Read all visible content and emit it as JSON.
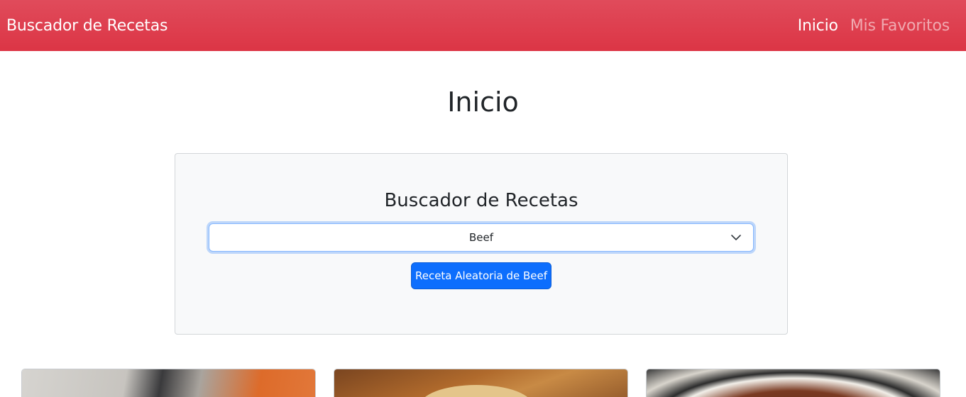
{
  "navbar": {
    "brand": "Buscador de Recetas",
    "links": [
      {
        "label": "Inicio",
        "active": true
      },
      {
        "label": "Mis Favoritos",
        "active": false
      }
    ],
    "color": "#dc3545"
  },
  "page": {
    "title": "Inicio"
  },
  "search": {
    "title": "Buscador de Recetas",
    "category_selected": "Beef",
    "random_button_label": "Receta Aleatoria de Beef",
    "button_color": "#0d6efd"
  },
  "recipes": [
    {
      "image": "recipe-thumbnail"
    },
    {
      "image": "recipe-thumbnail"
    },
    {
      "image": "recipe-thumbnail"
    }
  ]
}
